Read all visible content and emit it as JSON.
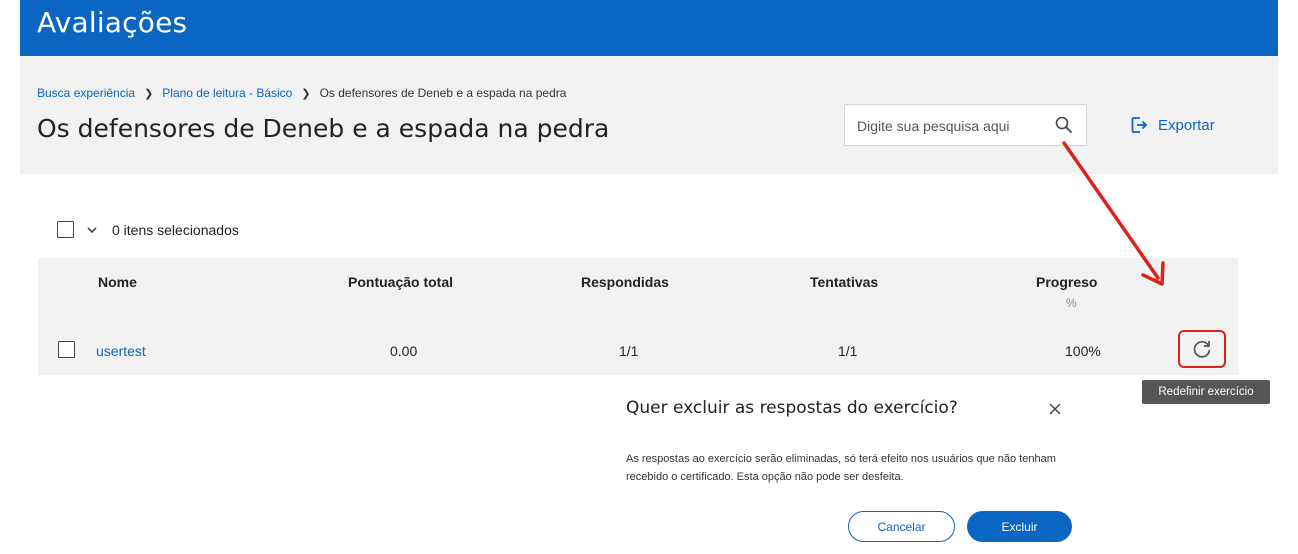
{
  "header": {
    "app_title": "Avaliações"
  },
  "breadcrumb": {
    "items": [
      "Busca experiência",
      "Plano de leitura - Básico",
      "Os defensores de Deneb e a espada na pedra"
    ]
  },
  "page": {
    "title": "Os defensores de Deneb e a espada na pedra"
  },
  "search": {
    "placeholder": "Digite sua pesquisa aqui",
    "value": ""
  },
  "export": {
    "label": "Exportar"
  },
  "selection": {
    "count_label": "0 itens selecionados"
  },
  "table": {
    "columns": {
      "name": "Nome",
      "score": "Pontuação total",
      "answered": "Respondidas",
      "attempts": "Tentativas",
      "progress": "Progreso",
      "progress_unit": "%"
    },
    "rows": [
      {
        "name": "usertest",
        "score": "0.00",
        "answered": "1/1",
        "attempts": "1/1",
        "progress": "100%"
      }
    ]
  },
  "tooltip": {
    "text": "Redefinir exercício"
  },
  "dialog": {
    "title": "Quer excluir as respostas do exercício?",
    "body": "As respostas ao exercício serão eliminadas, só terá efeito nos usuários que não tenham recebido o certificado. Esta opção não pode ser desfeita.",
    "cancel_label": "Cancelar",
    "confirm_label": "Excluir"
  },
  "colors": {
    "brand": "#0b66c3",
    "highlight": "#e0201a",
    "panel": "#f2f2f2"
  },
  "icons": [
    "chevron-right-icon",
    "search-icon",
    "export-icon",
    "chevron-down-icon",
    "reset-icon",
    "close-icon",
    "annotation-arrow"
  ]
}
